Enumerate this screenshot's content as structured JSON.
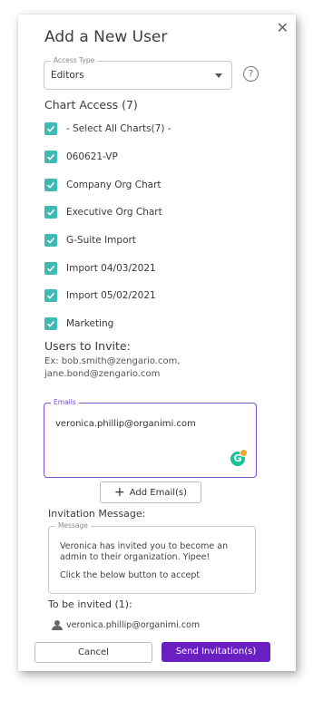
{
  "dialog": {
    "title": "Add a New User",
    "close_glyph": "✕"
  },
  "access_type": {
    "legend": "Access Type",
    "value": "Editors",
    "help_glyph": "?"
  },
  "chart_access": {
    "heading": "Chart Access (7)",
    "items": [
      {
        "label": "- Select All Charts(7) -",
        "checked": true
      },
      {
        "label": "060621-VP",
        "checked": true
      },
      {
        "label": "Company Org Chart",
        "checked": true
      },
      {
        "label": "Executive Org Chart",
        "checked": true
      },
      {
        "label": "G-Suite Import",
        "checked": true
      },
      {
        "label": "Import 04/03/2021",
        "checked": true
      },
      {
        "label": "Import 05/02/2021",
        "checked": true
      },
      {
        "label": "Marketing",
        "checked": true
      }
    ]
  },
  "users_to_invite": {
    "heading": "Users to Invite:",
    "hint_line1": "Ex: bob.smith@zengario.com,",
    "hint_line2": "jane.bond@zengario.com"
  },
  "emails": {
    "legend": "Emails",
    "value": "veronica.phillip@organimi.com"
  },
  "add_email": {
    "label": "Add Email(s)"
  },
  "invitation_message": {
    "heading": "Invitation Message:",
    "legend": "Message",
    "line1": "Veronica has invited you to become an admin to their organization. Yipee!",
    "line2": "Click the below button to accept"
  },
  "to_be_invited": {
    "heading": "To be invited (1):",
    "users": [
      "veronica.phillip@organimi.com"
    ]
  },
  "actions": {
    "cancel_label": "Cancel",
    "send_label": "Send Invitation(s)"
  },
  "colors": {
    "checkbox": "#3fbab3",
    "focus_border": "#7a4fd0",
    "primary_button": "#6a1fc2",
    "grammarly": "#15c39a"
  }
}
